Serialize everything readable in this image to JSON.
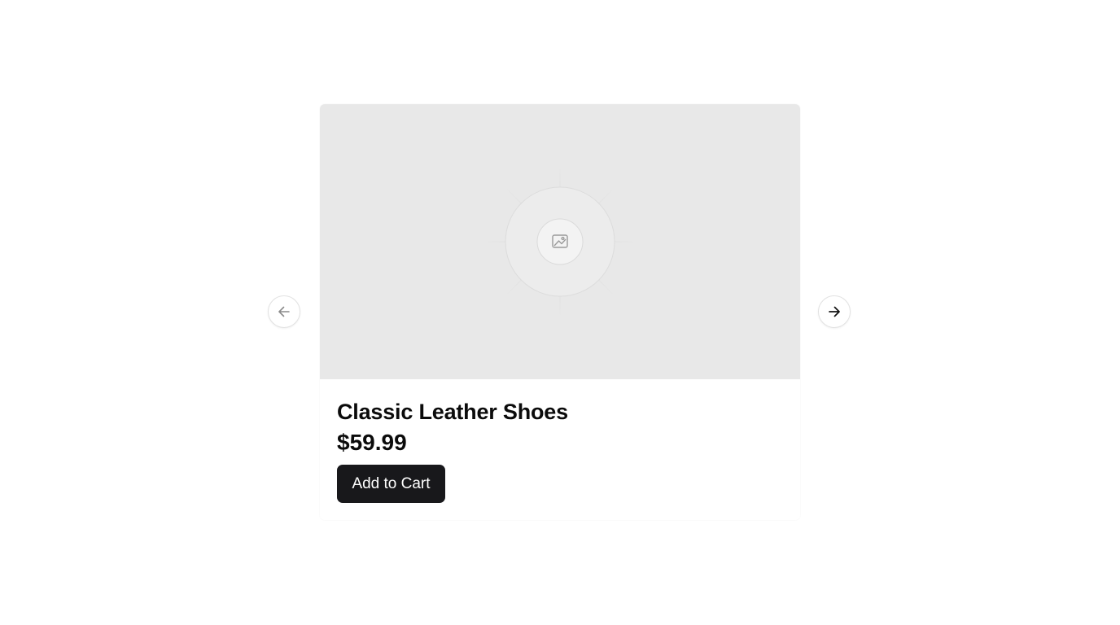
{
  "carousel": {
    "prev_button": {
      "icon": "arrow-left-icon",
      "enabled": false
    },
    "next_button": {
      "icon": "arrow-right-icon",
      "enabled": true
    }
  },
  "product": {
    "image_placeholder_icon": "image-icon",
    "title": "Classic Leather Shoes",
    "price": "$59.99",
    "add_to_cart_label": "Add to Cart"
  },
  "colors": {
    "button_background": "#18181b",
    "button_text": "#ffffff",
    "image_placeholder": "#e8e8e8",
    "disabled_arrow": "#8a8a8a",
    "enabled_arrow": "#111111"
  }
}
